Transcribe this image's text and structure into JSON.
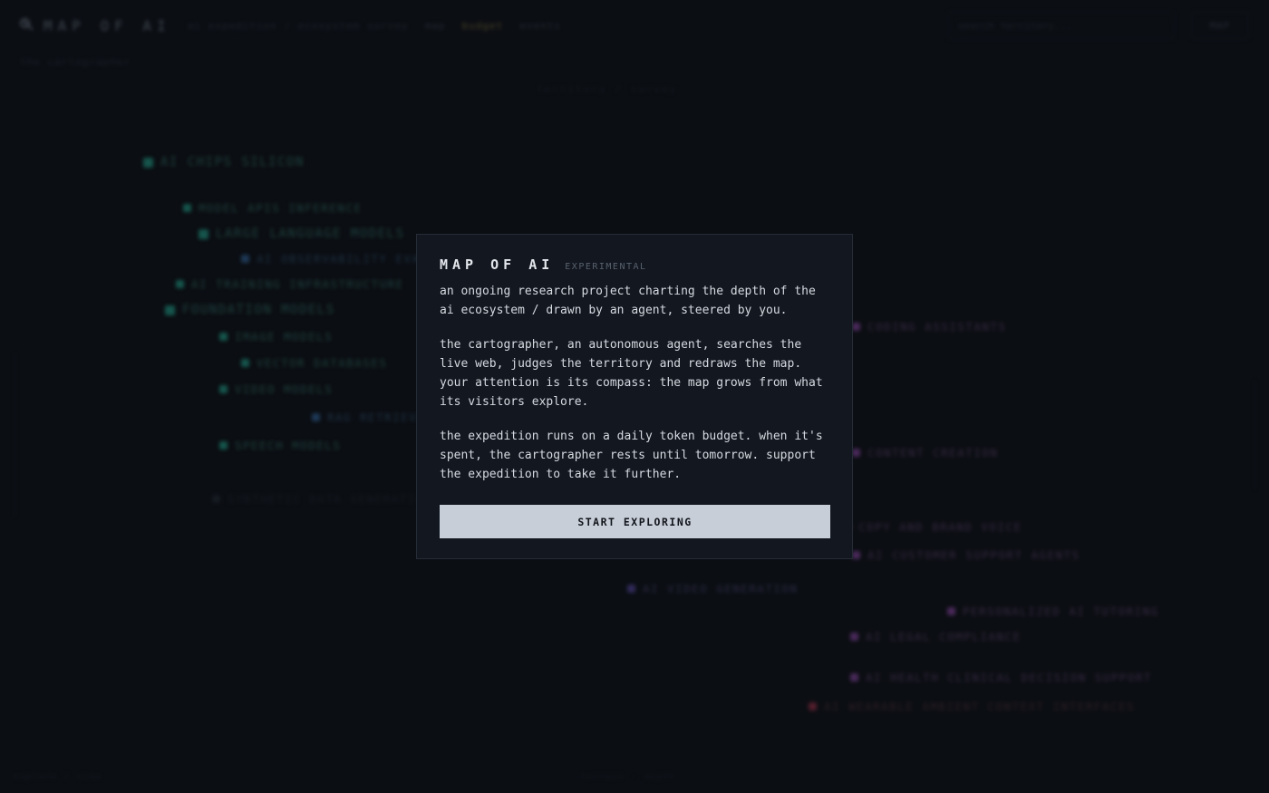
{
  "header": {
    "logo_text": "MAP OF AI",
    "tagline": "ai expedition / ecosystem survey",
    "nav": [
      "map",
      "budget",
      "events"
    ],
    "search_placeholder": "search territory...",
    "map_button": "MAP"
  },
  "background": {
    "sub_label": "the cartographer",
    "center_label": "territory / survey",
    "nodes": [
      {
        "label": "AI CHIPS SILICON",
        "color": "teal",
        "big": true
      },
      {
        "label": "MODEL APIS INFERENCE",
        "color": "teal"
      },
      {
        "label": "LARGE LANGUAGE MODELS",
        "color": "teal",
        "big": true
      },
      {
        "label": "AI OBSERVABILITY EVALS",
        "color": "blue"
      },
      {
        "label": "AI TRAINING INFRASTRUCTURE",
        "color": "teal"
      },
      {
        "label": "FOUNDATION MODELS",
        "color": "teal",
        "big": true
      },
      {
        "label": "IMAGE MODELS",
        "color": "teal"
      },
      {
        "label": "VECTOR DATABASES",
        "color": "teal"
      },
      {
        "label": "VIDEO MODELS",
        "color": "teal"
      },
      {
        "label": "RAG RETRIEVAL",
        "color": "blue"
      },
      {
        "label": "SPEECH MODELS",
        "color": "teal"
      },
      {
        "label": "SYNTHETIC DATA GENERATION",
        "color": "dim"
      },
      {
        "label": "CODING ASSISTANTS",
        "color": "purple"
      },
      {
        "label": "CONTENT CREATION",
        "color": "purple"
      },
      {
        "label": "COPY AND BRAND VOICE",
        "color": "purple"
      },
      {
        "label": "AI CUSTOMER SUPPORT AGENTS",
        "color": "purple"
      },
      {
        "label": "AI VIDEO GENERATION",
        "color": "violet"
      },
      {
        "label": "PERSONALIZED AI TUTORING",
        "color": "purple"
      },
      {
        "label": "AI LEGAL COMPLIANCE",
        "color": "purple"
      },
      {
        "label": "AI HEALTH CLINICAL DECISION SUPPORT",
        "color": "purple"
      },
      {
        "label": "AI WEARABLE AMBIENT CONTEXT INTERFACES",
        "color": "red"
      }
    ],
    "footer_left": "explore / view",
    "footer_center": "terrain · depth"
  },
  "modal": {
    "title": "MAP OF AI",
    "badge": "EXPERIMENTAL",
    "p1": "an ongoing research project charting the depth of the ai ecosystem / drawn by an agent, steered by you.",
    "p2": "the cartographer, an autonomous agent, searches the live web, judges the territory and redraws the map. your attention is its compass: the map grows from what its visitors explore.",
    "p3": "the expedition runs on a daily token budget. when it's spent, the cartographer rests until tomorrow. support the expedition to take it further.",
    "cta": "START EXPLORING"
  }
}
